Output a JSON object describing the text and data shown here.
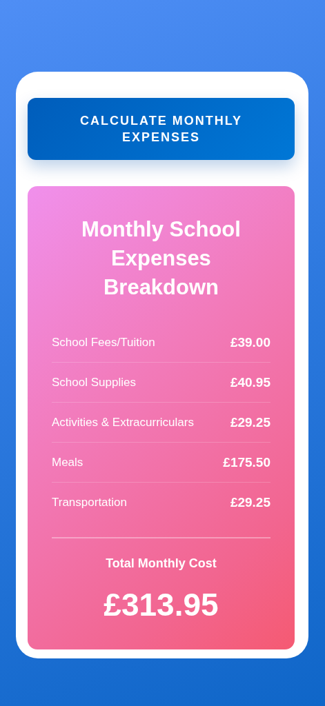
{
  "button": {
    "label": "CALCULATE MONTHLY EXPENSES"
  },
  "breakdown": {
    "title": "Monthly School Expenses Breakdown",
    "items": [
      {
        "label": "School Fees/Tuition",
        "amount": "£39.00"
      },
      {
        "label": "School Supplies",
        "amount": "£40.95"
      },
      {
        "label": "Activities & Extracurriculars",
        "amount": "£29.25"
      },
      {
        "label": "Meals",
        "amount": "£175.50"
      },
      {
        "label": "Transportation",
        "amount": "£29.25"
      }
    ],
    "total_label": "Total Monthly Cost",
    "total": "£313.95"
  }
}
